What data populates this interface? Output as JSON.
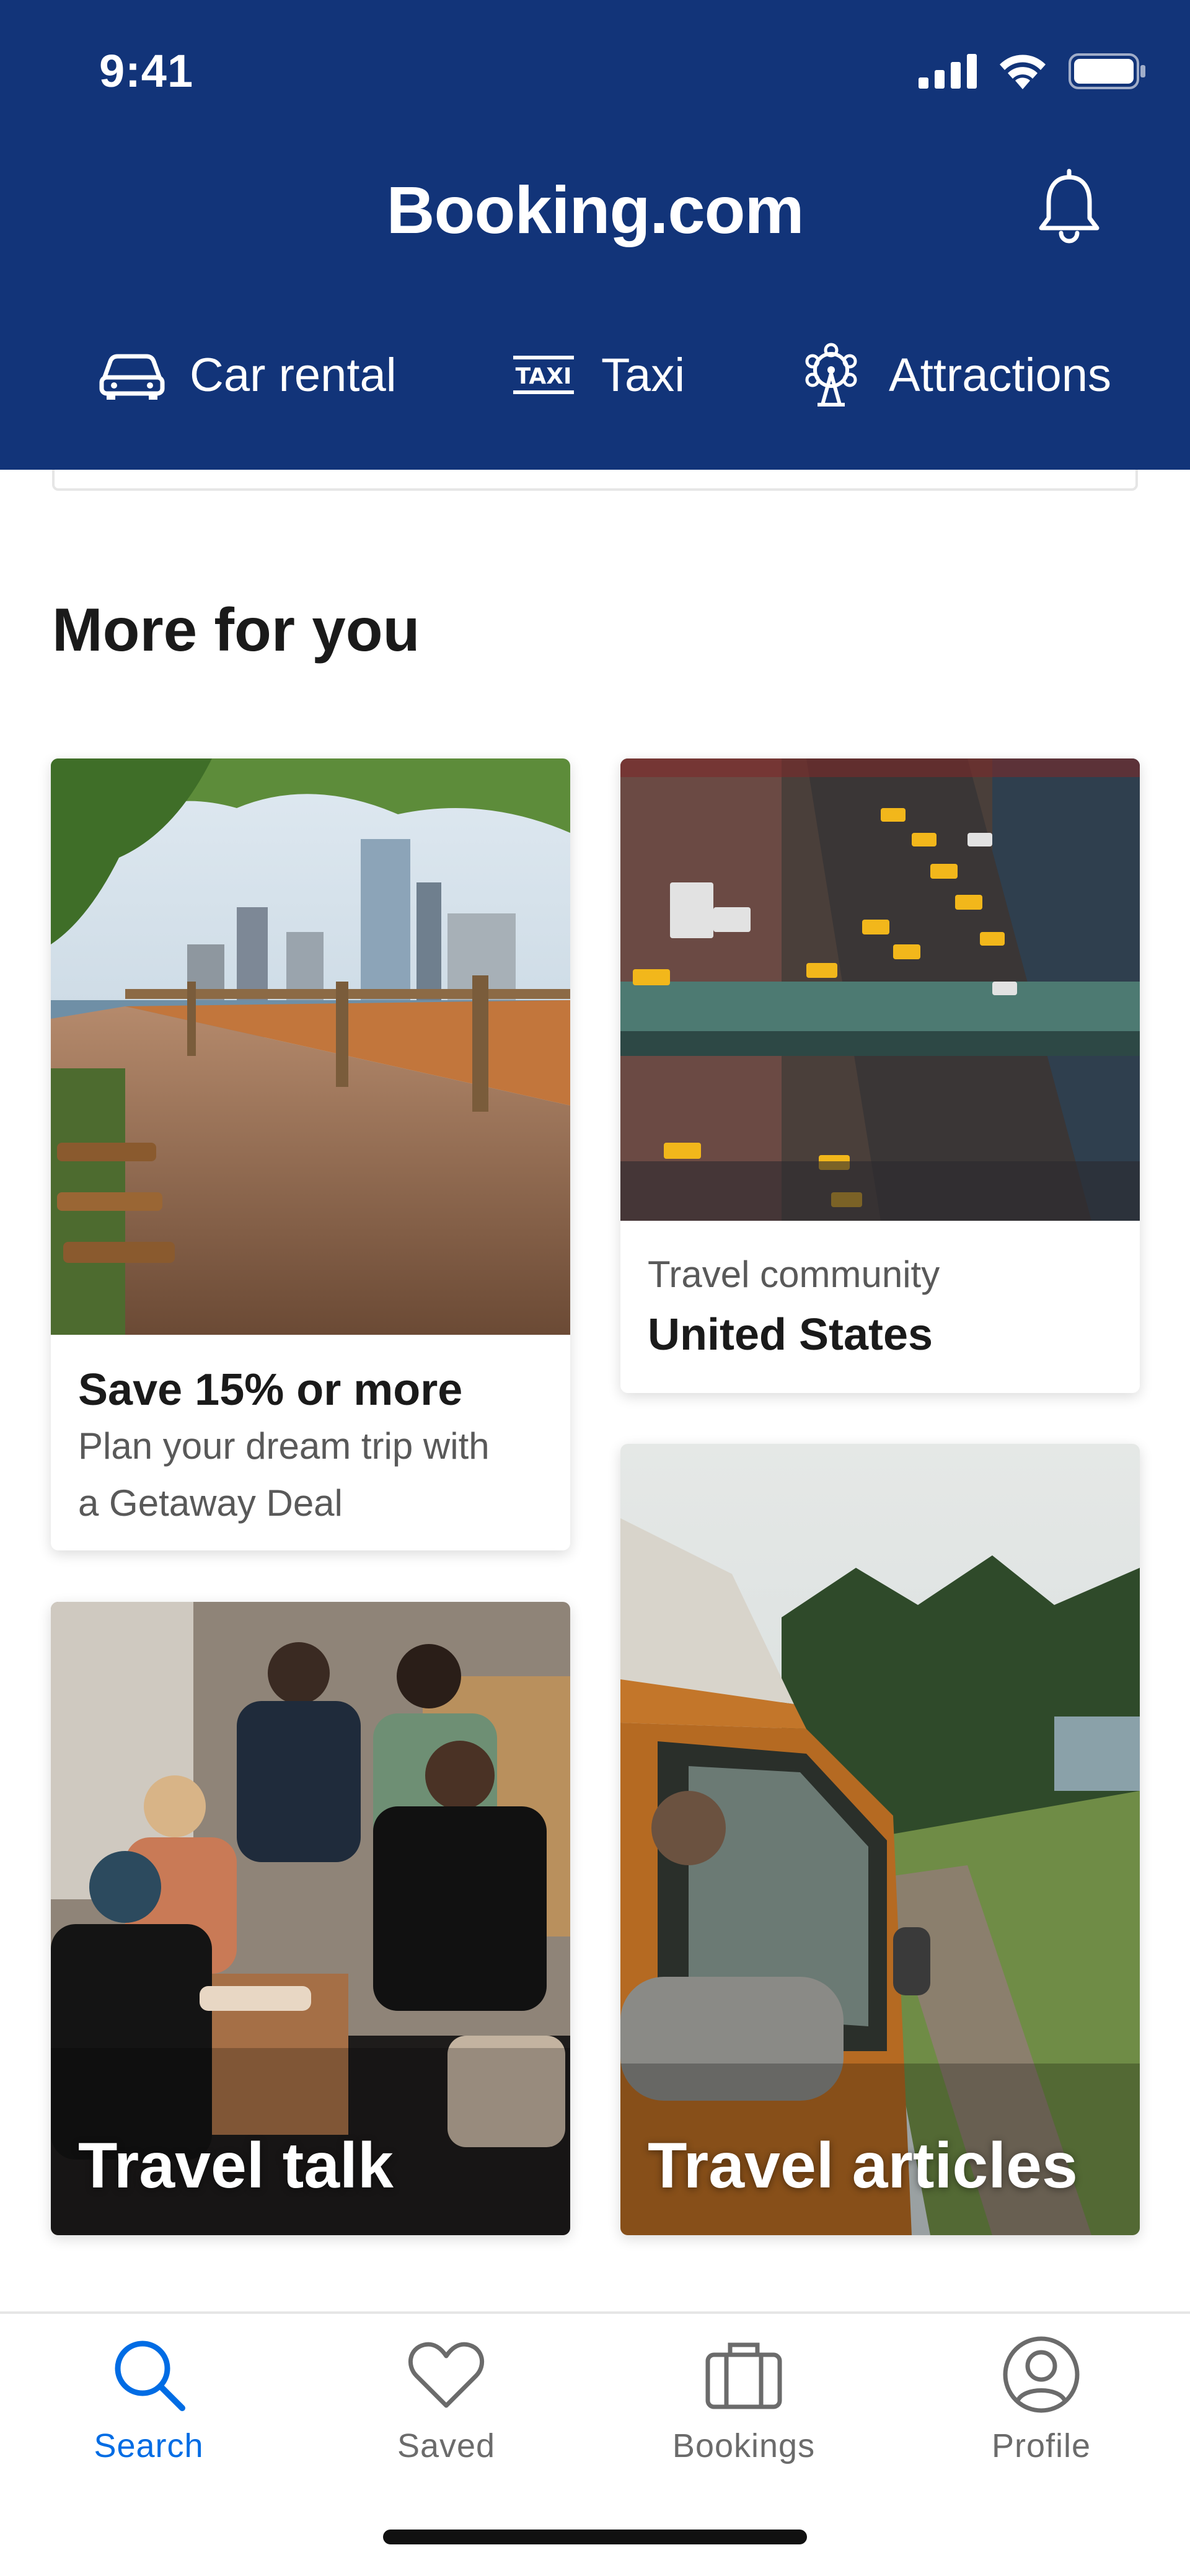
{
  "status_bar": {
    "time": "9:41"
  },
  "header": {
    "brand": "Booking.com",
    "nav": [
      {
        "label": "Car rental",
        "icon": "car-icon"
      },
      {
        "label": "Taxi",
        "icon": "taxi-icon"
      },
      {
        "label": "Attractions",
        "icon": "ferris-wheel-icon"
      }
    ]
  },
  "main": {
    "section_title": "More for you",
    "cards": {
      "deal": {
        "title": "Save 15% or more",
        "subtitle_line1": "Plan your dream trip with",
        "subtitle_line2": "a Getaway Deal"
      },
      "community": {
        "subtitle": "Travel community",
        "title": "United States"
      },
      "talk": {
        "title": "Travel talk"
      },
      "articles": {
        "title": "Travel articles"
      }
    }
  },
  "tabbar": {
    "tabs": [
      {
        "label": "Search",
        "icon": "search-icon",
        "active": true
      },
      {
        "label": "Saved",
        "icon": "heart-icon"
      },
      {
        "label": "Bookings",
        "icon": "briefcase-icon"
      },
      {
        "label": "Profile",
        "icon": "profile-icon"
      }
    ]
  },
  "colors": {
    "header_bg": "#123479",
    "accent": "#006ce4",
    "text": "#1a1a1a",
    "muted": "#595959"
  }
}
